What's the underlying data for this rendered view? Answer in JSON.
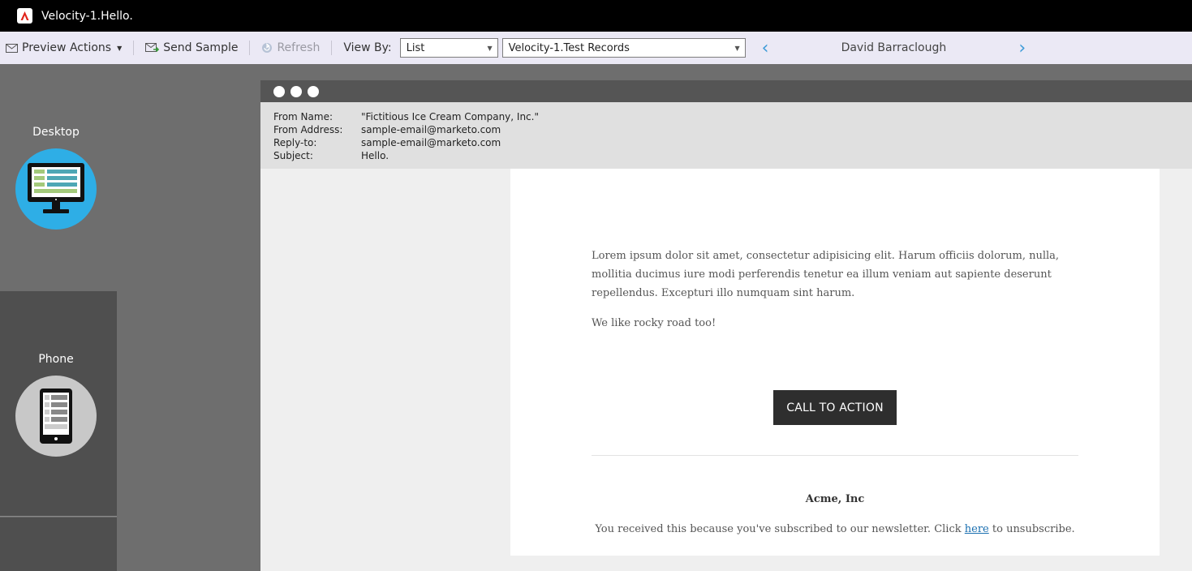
{
  "window": {
    "title": "Velocity-1.Hello."
  },
  "toolbar": {
    "preview_actions": "Preview Actions",
    "send_sample": "Send Sample",
    "refresh": "Refresh",
    "view_by_label": "View By:",
    "view_by_value": "List",
    "list_value": "Velocity-1.Test Records",
    "record_name": "David Barraclough"
  },
  "devices": {
    "desktop": "Desktop",
    "phone": "Phone"
  },
  "email_headers": {
    "from_name_label": "From Name:",
    "from_name": "\"Fictitious Ice Cream Company, Inc.\"",
    "from_address_label": "From Address:",
    "from_address": "sample-email@marketo.com",
    "reply_to_label": "Reply-to:",
    "reply_to": "sample-email@marketo.com",
    "subject_label": "Subject:",
    "subject": "Hello."
  },
  "email_body": {
    "paragraph1": "Lorem ipsum dolor sit amet, consectetur adipisicing elit. Harum officiis dolorum, nulla, mollitia ducimus iure modi perferendis tenetur ea illum veniam aut sapiente deserunt repellendus. Excepturi illo numquam sint harum.",
    "paragraph2": "We like rocky road too!",
    "cta": "CALL TO ACTION",
    "company": "Acme, Inc",
    "footer_before": "You received this because you've subscribed to our newsletter. Click ",
    "footer_link": "here",
    "footer_after": " to unsubscribe."
  },
  "colors": {
    "accent": "#3d9bd8",
    "desktop_circle": "#2eaee6",
    "phone_circle": "#c8c8c8",
    "brand": "#e0241b"
  }
}
